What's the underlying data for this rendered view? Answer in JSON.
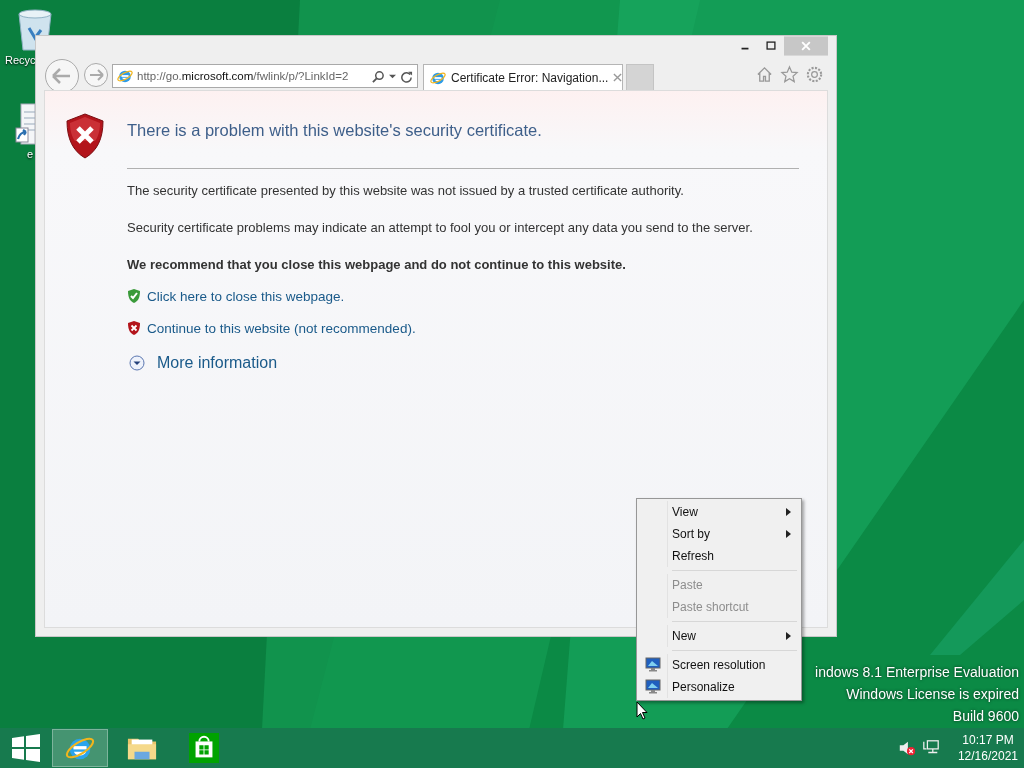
{
  "desktop": {
    "icons": [
      {
        "label": "Recyc",
        "kind": "recycle"
      },
      {
        "label": "e",
        "kind": "document"
      }
    ],
    "watermark": [
      "indows 8.1 Enterprise Evaluation",
      "Windows License is expired",
      "Build 9600"
    ]
  },
  "window": {
    "address": {
      "prefix": "http://go.",
      "domain": "microsoft.com",
      "path": "/fwlink/p/?LinkId=2"
    },
    "tabs": [
      {
        "title": "Certificate Error: Navigation...",
        "selected": true
      }
    ],
    "page": {
      "heading": "There is a problem with this website's security certificate.",
      "paragraphs": [
        "The security certificate presented by this website was not issued by a trusted certificate authority.",
        "Security certificate problems may indicate an attempt to fool you or intercept any data you send to the server."
      ],
      "recommendation": "We recommend that you close this webpage and do not continue to this website.",
      "links": [
        {
          "text": "Click here to close this webpage.",
          "kind": "safe"
        },
        {
          "text": "Continue to this website (not recommended).",
          "kind": "danger"
        }
      ],
      "more": {
        "text": "More information",
        "expanded": false
      }
    }
  },
  "context_menu": {
    "items": [
      {
        "kind": "item",
        "label": "View",
        "submenu": true,
        "disabled": false,
        "icon": false
      },
      {
        "kind": "item",
        "label": "Sort by",
        "submenu": true,
        "disabled": false,
        "icon": false
      },
      {
        "kind": "item",
        "label": "Refresh",
        "submenu": false,
        "disabled": false,
        "icon": false
      },
      {
        "kind": "separator"
      },
      {
        "kind": "item",
        "label": "Paste",
        "submenu": false,
        "disabled": true,
        "icon": false
      },
      {
        "kind": "item",
        "label": "Paste shortcut",
        "submenu": false,
        "disabled": true,
        "icon": false
      },
      {
        "kind": "separator"
      },
      {
        "kind": "item",
        "label": "New",
        "submenu": true,
        "disabled": false,
        "icon": false
      },
      {
        "kind": "separator"
      },
      {
        "kind": "item",
        "label": "Screen resolution",
        "submenu": false,
        "disabled": false,
        "icon": true
      },
      {
        "kind": "item",
        "label": "Personalize",
        "submenu": false,
        "disabled": false,
        "icon": true
      }
    ]
  },
  "taskbar": {
    "apps": [
      {
        "kind": "browser",
        "selected": true
      },
      {
        "kind": "folder",
        "selected": false
      },
      {
        "kind": "store",
        "selected": false
      }
    ],
    "time": "10:17 PM",
    "date": "12/16/2021"
  }
}
